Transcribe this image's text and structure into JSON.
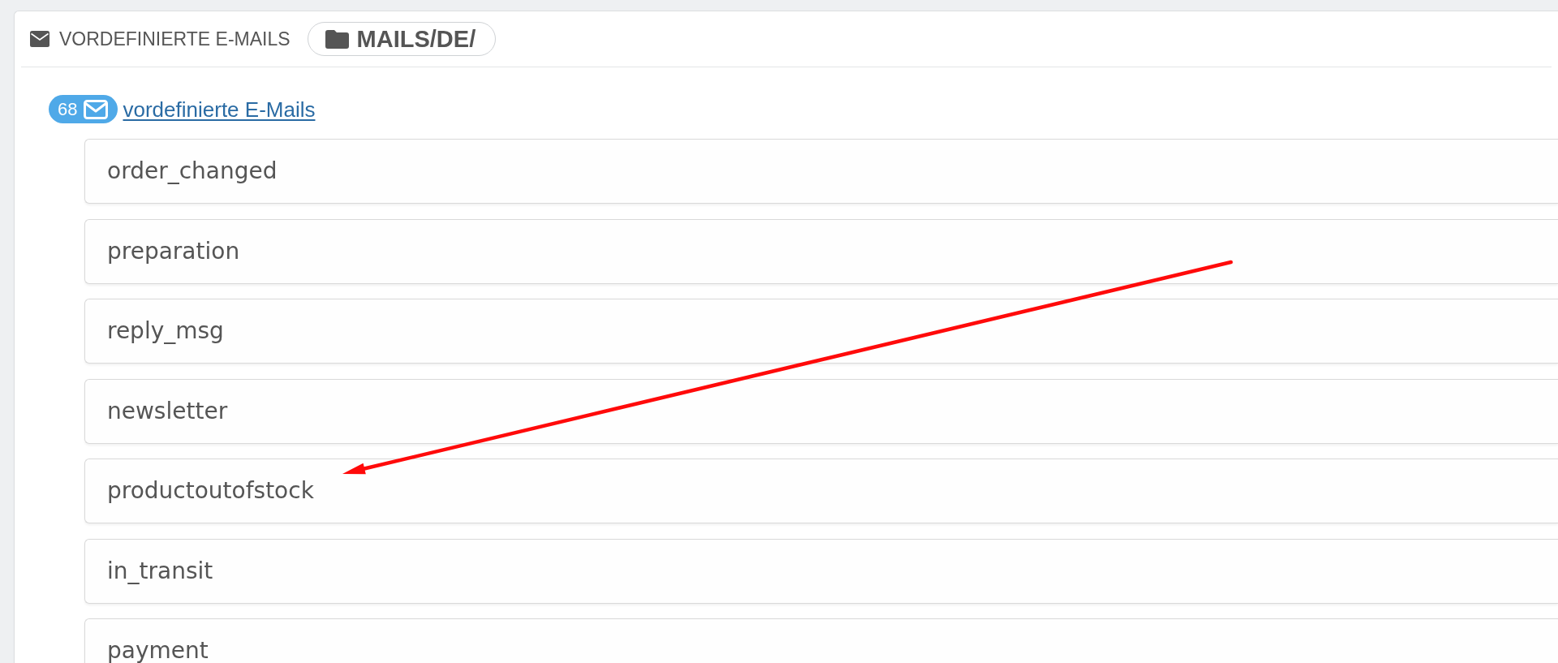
{
  "panel": {
    "title": "VORDEFINIERTE E-MAILS",
    "folder": "MAILS/DE/"
  },
  "mail_group": {
    "count": "68",
    "link": "vordefinierte E-Mails"
  },
  "templates": [
    "order_changed",
    "preparation",
    "reply_msg",
    "newsletter",
    "productoutofstock",
    "in_transit",
    "payment"
  ]
}
